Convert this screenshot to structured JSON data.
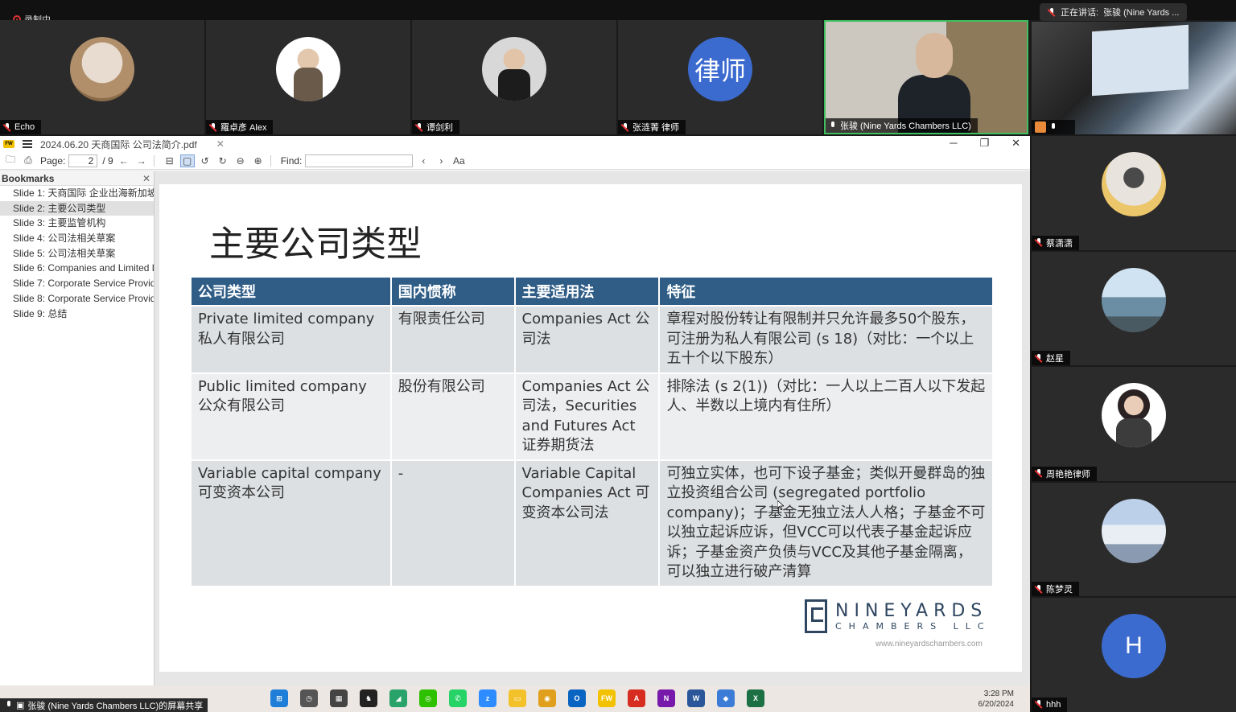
{
  "recording_label": "录制中",
  "speaking": {
    "label": "正在讲话:",
    "name": "张骏 (Nine Yards ..."
  },
  "top_participants": [
    {
      "name": "Echo",
      "avatar": "photo-cat",
      "muted": true
    },
    {
      "name": "羅卓彥 Alex",
      "avatar": "photo-man",
      "muted": true
    },
    {
      "name": "谭剑利",
      "avatar": "photo-man",
      "muted": true
    },
    {
      "name": "张涟菁 律师",
      "avatar_text": "律师",
      "muted": true
    },
    {
      "name": "张骏 (Nine Yards Chambers LLC)",
      "avatar": "video",
      "muted": false
    }
  ],
  "right_participants": [
    {
      "name": "蔡潇潇",
      "avatar": "photo-cat"
    },
    {
      "name": "赵星",
      "avatar": "photo-sea"
    },
    {
      "name": "周艳艳律师",
      "avatar": "photo-woman"
    },
    {
      "name": "陈梦灵",
      "avatar": "photo-beach"
    },
    {
      "name": "hhh",
      "avatar_text": "H"
    }
  ],
  "pdf": {
    "app_icon": "FW",
    "title": "2024.06.20 天商国际 公司法简介.pdf",
    "page_label": "Page:",
    "page_current": "2",
    "page_total": "/ 9",
    "find_label": "Find:",
    "sidebar_title": "Bookmarks",
    "bookmarks": [
      "Slide 1: 天商国际 企业出海新加坡",
      "Slide 2: 主要公司类型",
      "Slide 3: 主要监管机构",
      "Slide 4: 公司法相关草案",
      "Slide 5: 公司法相关草案",
      "Slide 6: Companies and Limited L",
      "Slide 7: Corporate Service Provide",
      "Slide 8: Corporate Service Provide",
      "Slide 9: 总结"
    ],
    "current_bookmark_index": 1
  },
  "slide": {
    "title": "主要公司类型",
    "headers": [
      "公司类型",
      "国内惯称",
      "主要适用法",
      "特征"
    ],
    "rows": [
      [
        "Private limited company 私人有限公司",
        "有限责任公司",
        "Companies Act 公司法",
        "章程对股份转让有限制并只允许最多50个股东，可注册为私人有限公司 (s 18)（对比：一个以上五十个以下股东）"
      ],
      [
        "Public limited company 公众有限公司",
        "股份有限公司",
        "Companies Act 公司法，Securities and Futures Act 证券期货法",
        "排除法 (s 2(1))（对比：一人以上二百人以下发起人、半数以上境内有住所）"
      ],
      [
        "Variable capital company 可变资本公司",
        "-",
        "Variable Capital Companies Act 可变资本公司法",
        "可独立实体，也可下设子基金；类似开曼群岛的独立投资组合公司 (segregated portfolio company)；子基金无独立法人人格；子基金不可以独立起诉应诉，但VCC可以代表子基金起诉应诉；子基金资产负债与VCC及其他子基金隔离，可以独立进行破产清算"
      ]
    ],
    "logo_top": "NINEYARDS",
    "logo_bottom": "CHAMBERS LLC",
    "logo_url": "www.nineyardschambers.com"
  },
  "share_label": "张骏 (Nine Yards Chambers LLC)的屏幕共享",
  "taskbar_apps": [
    "windows-start",
    "clock-app",
    "calculator",
    "chess",
    "greenapp",
    "wechat",
    "whatsapp",
    "zoom",
    "file-explorer",
    "chrome",
    "outlook",
    "foxit",
    "acrobat",
    "onenote",
    "word",
    "teams",
    "excel"
  ],
  "clock": {
    "time": "3:28 PM",
    "date": "6/20/2024"
  },
  "colors": {
    "header_blue": "#2f5d86",
    "active_border": "#3fbf5e",
    "avatar_blue": "#3c6bd0"
  }
}
